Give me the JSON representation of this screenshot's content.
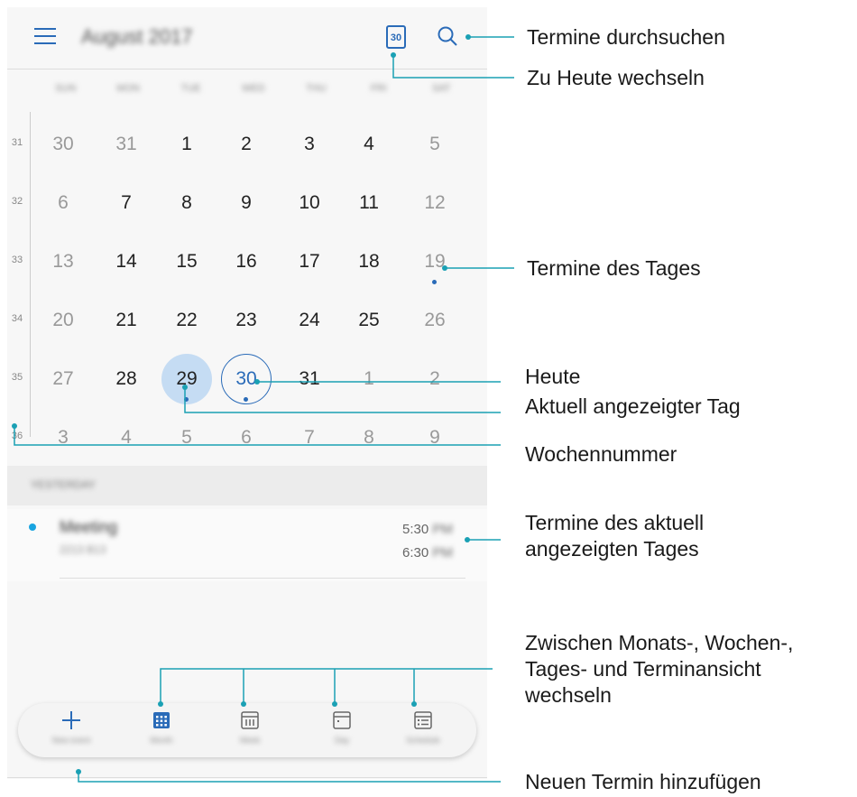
{
  "header": {
    "month_title": "August 2017",
    "today_icon_day": "30"
  },
  "weekdays": [
    "SUN",
    "MON",
    "TUE",
    "WED",
    "THU",
    "FRI",
    "SAT"
  ],
  "weeks": [
    {
      "num": "31",
      "days": [
        {
          "d": "30",
          "dim": true
        },
        {
          "d": "31",
          "dim": true
        },
        {
          "d": "1"
        },
        {
          "d": "2"
        },
        {
          "d": "3"
        },
        {
          "d": "4"
        },
        {
          "d": "5",
          "dim": true
        }
      ]
    },
    {
      "num": "32",
      "days": [
        {
          "d": "6",
          "dim": true
        },
        {
          "d": "7"
        },
        {
          "d": "8"
        },
        {
          "d": "9"
        },
        {
          "d": "10"
        },
        {
          "d": "11"
        },
        {
          "d": "12",
          "dim": true
        }
      ]
    },
    {
      "num": "33",
      "days": [
        {
          "d": "13",
          "dim": true
        },
        {
          "d": "14"
        },
        {
          "d": "15"
        },
        {
          "d": "16"
        },
        {
          "d": "17"
        },
        {
          "d": "18"
        },
        {
          "d": "19",
          "dim": true,
          "dot": true
        }
      ]
    },
    {
      "num": "34",
      "days": [
        {
          "d": "20",
          "dim": true
        },
        {
          "d": "21"
        },
        {
          "d": "22"
        },
        {
          "d": "23"
        },
        {
          "d": "24"
        },
        {
          "d": "25"
        },
        {
          "d": "26",
          "dim": true
        }
      ]
    },
    {
      "num": "35",
      "days": [
        {
          "d": "27",
          "dim": true
        },
        {
          "d": "28"
        },
        {
          "d": "29",
          "sel": true,
          "dot": true
        },
        {
          "d": "30",
          "today": true,
          "dot": true
        },
        {
          "d": "31"
        },
        {
          "d": "1",
          "dim": true
        },
        {
          "d": "2",
          "dim": true
        }
      ]
    },
    {
      "num": "36",
      "days": [
        {
          "d": "3",
          "dim": true
        },
        {
          "d": "4",
          "dim": true
        },
        {
          "d": "5",
          "dim": true
        },
        {
          "d": "6",
          "dim": true
        },
        {
          "d": "7",
          "dim": true
        },
        {
          "d": "8",
          "dim": true
        },
        {
          "d": "9",
          "dim": true
        }
      ]
    }
  ],
  "agenda": {
    "section_label": "YESTERDAY",
    "event": {
      "title": "Meeting",
      "location": "2213 B13",
      "start_time": "5:30",
      "start_ampm": "PM",
      "end_time": "6:30",
      "end_ampm": "PM"
    }
  },
  "bottom_bar": [
    {
      "label": "New event",
      "icon": "plus-icon"
    },
    {
      "label": "Month",
      "icon": "month-view-icon"
    },
    {
      "label": "Week",
      "icon": "week-view-icon"
    },
    {
      "label": "Day",
      "icon": "day-view-icon"
    },
    {
      "label": "Schedule",
      "icon": "schedule-view-icon"
    }
  ],
  "callouts": {
    "search": "Termine durchsuchen",
    "today": "Zu Heute wechseln",
    "day_events": "Termine des Tages",
    "heute": "Heute",
    "current_day": "Aktuell angezeigter Tag",
    "week_number": "Wochennummer",
    "current_events_1": "Termine des aktuell",
    "current_events_2": "angezeigten Tages",
    "switch_1": "Zwischen Monats-, Wochen-,",
    "switch_2": "Tages- und Terminansicht",
    "switch_3": "wechseln",
    "new_event": "Neuen Termin hinzufügen"
  },
  "colors": {
    "accent": "#2a6bb8",
    "callout_line": "#1aa0b4",
    "event_dot": "#19a4e0"
  }
}
